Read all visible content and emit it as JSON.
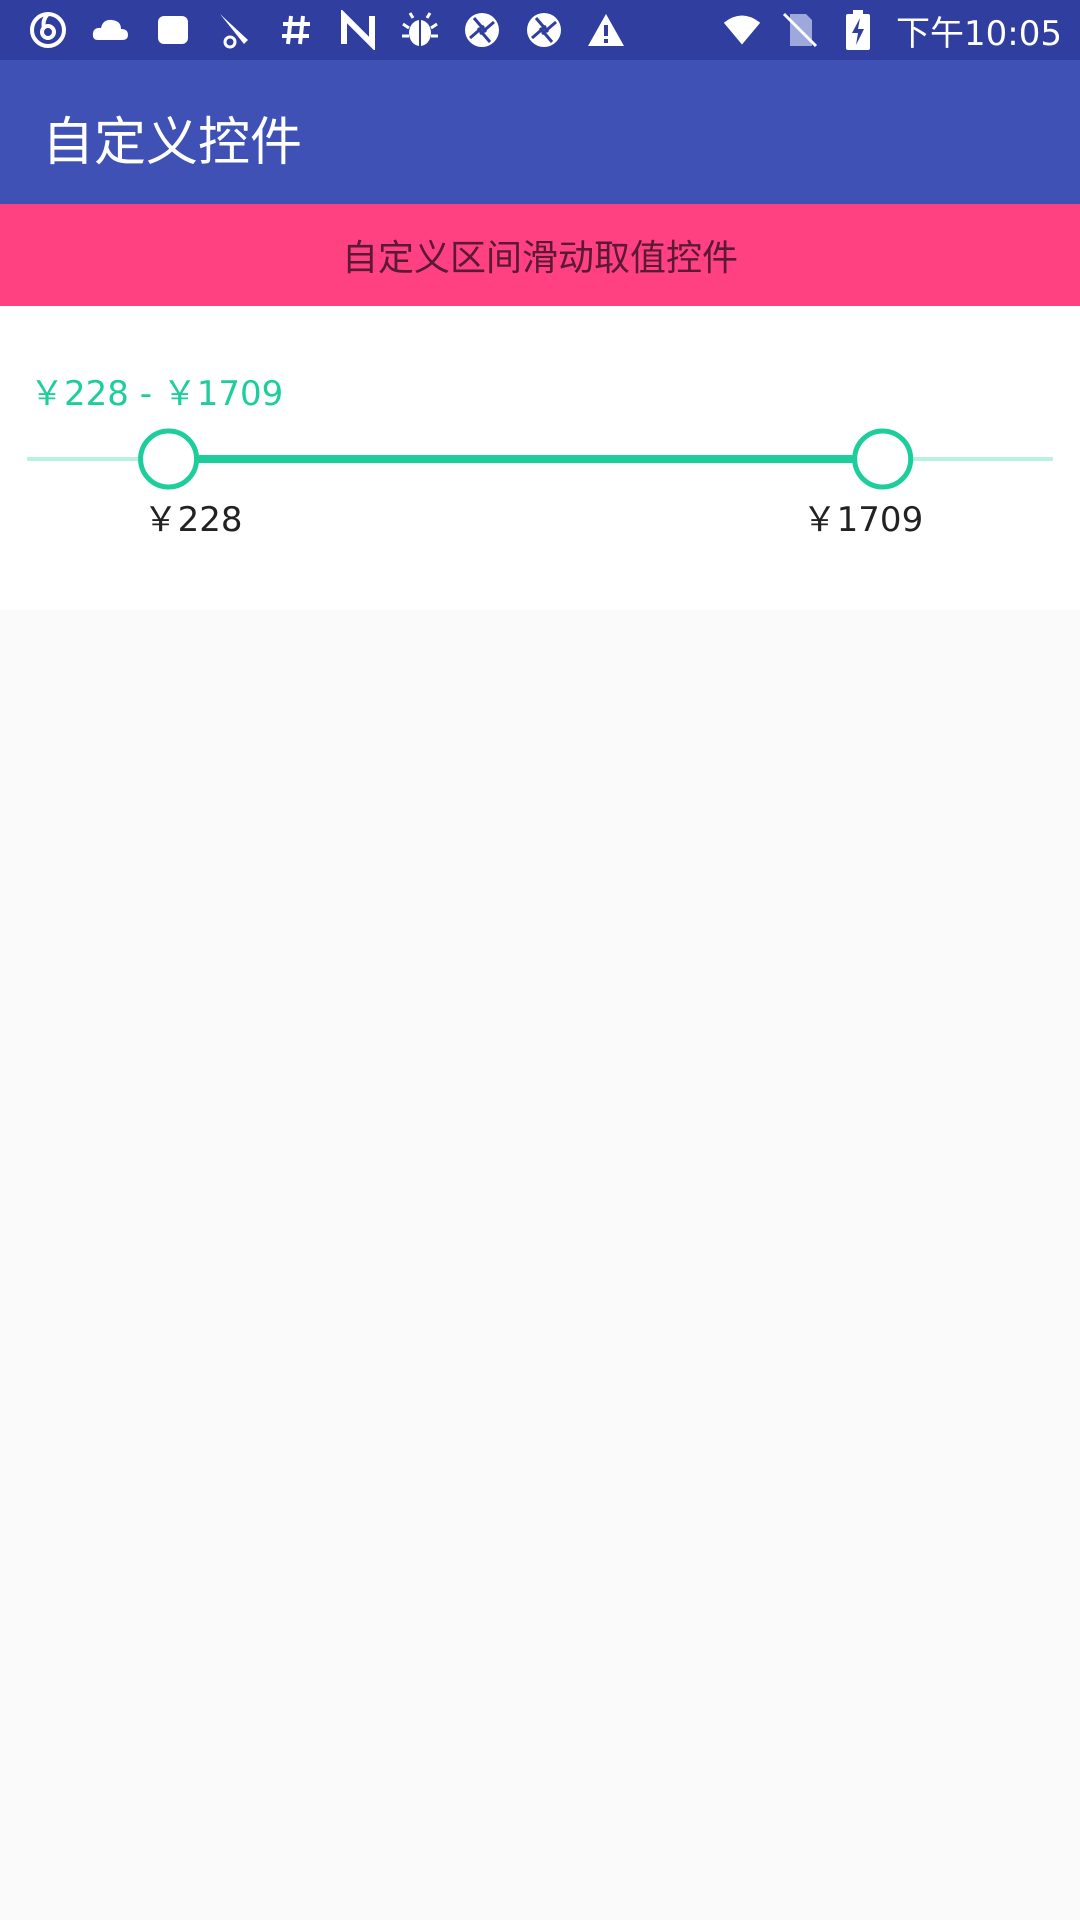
{
  "status_bar": {
    "left_icons": [
      "netease-music-icon",
      "cloud-icon",
      "square-app-icon",
      "pencil-app-icon",
      "hashtag-icon",
      "n-app-icon",
      "bug-icon",
      "aperture-icon",
      "aperture-icon-2",
      "warning-icon"
    ],
    "right_icons": [
      "wifi-icon",
      "no-sim-icon",
      "battery-charging-icon"
    ],
    "time": "下午10:05"
  },
  "app_bar": {
    "title": "自定义控件"
  },
  "banner": {
    "text": "自定义区间滑动取值控件"
  },
  "range": {
    "summary": "￥228 - ￥1709",
    "min_label": "￥228",
    "max_label": "￥1709",
    "low_fraction": 0.138,
    "high_fraction": 0.834
  },
  "colors": {
    "status_bar": "#303F9F",
    "app_bar": "#3F51B5",
    "banner": "#FF4081",
    "accent": "#1DCE9C",
    "track_inactive": "#B9F2E0"
  }
}
